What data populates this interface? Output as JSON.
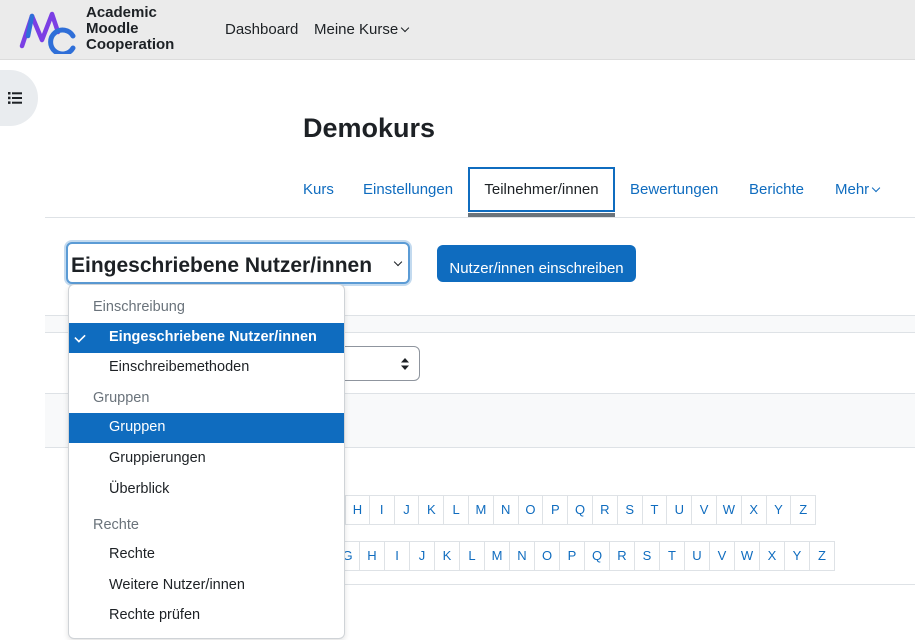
{
  "brand": {
    "line1": "Academic",
    "line2": "Moodle",
    "line3": "Cooperation"
  },
  "navbar": {
    "dashboard": "Dashboard",
    "my_courses": "Meine Kurse"
  },
  "page": {
    "title": "Demokurs"
  },
  "secondary_nav": {
    "tabs": [
      "Kurs",
      "Einstellungen",
      "Teilnehmer/innen",
      "Bewertungen",
      "Berichte",
      "Mehr"
    ],
    "active": "Teilnehmer/innen"
  },
  "participants": {
    "selected_view": "Eingeschriebene Nutzer/innen",
    "enrol_button": "Nutzer/innen einschreiben"
  },
  "dropdown": {
    "groups": [
      {
        "label": "Einschreibung",
        "options": [
          "Eingeschriebene Nutzer/innen",
          "Einschreibemethoden"
        ]
      },
      {
        "label": "Gruppen",
        "options": [
          "Gruppen",
          "Gruppierungen",
          "Überblick"
        ]
      },
      {
        "label": "Rechte",
        "options": [
          "Rechte",
          "Weitere Nutzer/innen",
          "Rechte prüfen"
        ]
      }
    ],
    "selected": "Eingeschriebene Nutzer/innen",
    "highlighted": "Gruppen"
  },
  "initials_first": [
    "H",
    "I",
    "J",
    "K",
    "L",
    "M",
    "N",
    "O",
    "P",
    "Q",
    "R",
    "S",
    "T",
    "U",
    "V",
    "W",
    "X",
    "Y",
    "Z"
  ],
  "initials_last": [
    "G",
    "H",
    "I",
    "J",
    "K",
    "L",
    "M",
    "N",
    "O",
    "P",
    "Q",
    "R",
    "S",
    "T",
    "U",
    "V",
    "W",
    "X",
    "Y",
    "Z"
  ],
  "colors": {
    "primary": "#0f6cbf",
    "navbar_bg": "#ebebeb",
    "logo_purple": "#7b3fe4",
    "logo_blue": "#2f6fd8"
  },
  "icons": {
    "drawer": "list-icon",
    "check": "check-icon",
    "select_arrows": "sort-arrows-icon"
  }
}
